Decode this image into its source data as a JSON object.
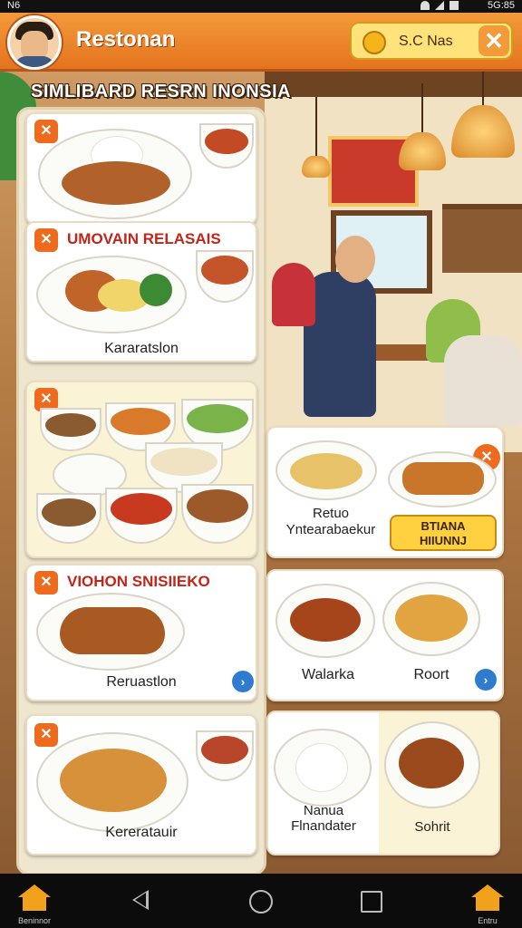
{
  "status_bar": {
    "left": "N6",
    "right": "5G:85"
  },
  "header": {
    "title": "Restonan",
    "coins_label": "S.C Nas",
    "close_symbol": "✕"
  },
  "banner": {
    "text": "SIMLIBARD RESRN INONSIA"
  },
  "cards": {
    "card1": {
      "label": ""
    },
    "card2": {
      "title": "UMOVAIN RELASAIS",
      "label": "Kararatslon"
    },
    "card3": {
      "label": ""
    },
    "card4": {
      "label_line1": "Retuo",
      "label_line2": "Yntearabaekur",
      "button_line1": "BTIANA",
      "button_line2": "HIIUNNJ"
    },
    "card5": {
      "title": "VIOHON SNISIIEKO",
      "label": "Reruastlon"
    },
    "card6": {
      "label_left": "Walarka",
      "label_right": "Roort"
    },
    "card7": {
      "label": "Kereratauir"
    },
    "card8": {
      "label_left_line1": "Nanua",
      "label_left_line2": "Flnandater",
      "label_right": "Sohrit"
    }
  },
  "icons": {
    "badge": "✕",
    "arrow": "›"
  },
  "nav": {
    "left_label": "Beninnor",
    "right_label": "Entru"
  },
  "colors": {
    "accent": "#e4741f",
    "title_red": "#c2261a",
    "button_yellow": "#ffd040",
    "link_blue": "#2f7bd0"
  }
}
